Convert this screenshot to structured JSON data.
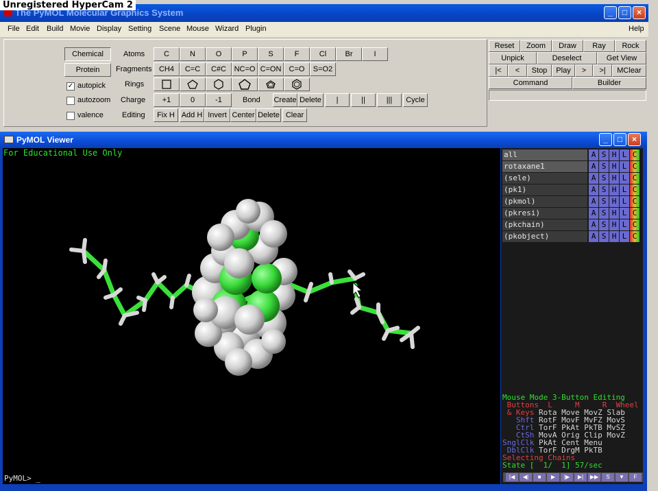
{
  "watermark": "Unregistered HyperCam 2",
  "main_window": {
    "title": "The PyMOL Molecular Graphics System",
    "controls": {
      "minimize": "_",
      "maximize": "□",
      "close": "×"
    }
  },
  "menubar": [
    "File",
    "Edit",
    "Build",
    "Movie",
    "Display",
    "Setting",
    "Scene",
    "Mouse",
    "Wizard",
    "Plugin",
    "Help"
  ],
  "builder": {
    "modes": {
      "chemical": "Chemical",
      "protein": "Protein"
    },
    "options": {
      "autopick": "autopick",
      "autozoom": "autozoom",
      "valence": "valence"
    },
    "autopick_checked": "✓",
    "rows": {
      "atoms_label": "Atoms",
      "atoms": [
        "C",
        "N",
        "O",
        "P",
        "S",
        "F",
        "Cl",
        "Br",
        "I"
      ],
      "fragments_label": "Fragments",
      "fragments": [
        "CH4",
        "C=C",
        "C#C",
        "NC=O",
        "C=ON",
        "C=O",
        "S=O2"
      ],
      "rings_label": "Rings",
      "charge_label": "Charge",
      "charges": [
        "+1",
        "0",
        "-1"
      ],
      "bond_label": "Bond",
      "bond_buttons": [
        "Create",
        "Delete",
        "|",
        "||",
        "|||",
        "Cycle"
      ],
      "editing_label": "Editing",
      "editing": [
        "Fix H",
        "Add H",
        "Invert",
        "Center",
        "Delete",
        "Clear"
      ]
    }
  },
  "control_panel": {
    "row1": [
      "Reset",
      "Zoom",
      "Draw",
      "Ray",
      "Rock"
    ],
    "row2": [
      "Unpick",
      "Deselect",
      "Get View"
    ],
    "row3": [
      "|<",
      "<",
      "Stop",
      "Play",
      ">",
      ">|",
      "MClear"
    ],
    "row4": [
      "Command",
      "Builder"
    ]
  },
  "viewer": {
    "title": "PyMOL Viewer",
    "edu_notice": "For Educational Use Only",
    "prompt": "PyMOL> _"
  },
  "objects": [
    "all",
    "rotaxane1",
    "(sele)",
    "(pk1)",
    "(pkmol)",
    "(pkresi)",
    "(pkchain)",
    "(pkobject)"
  ],
  "object_buttons": [
    "A",
    "S",
    "H",
    "L",
    "C"
  ],
  "mouse_mode": {
    "line1": "Mouse Mode 3-Button Editing",
    "buttons_line": " Buttons  L     M     R  Wheel",
    "rows": [
      {
        "key": " & Keys",
        "vals": " Rota Move MovZ Slab"
      },
      {
        "key": "   Shft",
        "vals": " RotF MovF MvFZ MovS"
      },
      {
        "key": "   Ctrl",
        "vals": " TorF PkAt PkTB MvSZ"
      },
      {
        "key": "   CtSh",
        "vals": " MovA Orig Clip MovZ"
      },
      {
        "key": "SnglClk",
        "vals": " PkAt Cent Menu"
      },
      {
        "key": " DblClk",
        "vals": " TorF DrgM PkTB"
      }
    ],
    "selecting": "Selecting Chains",
    "state": "State [  1/  1] 57/sec"
  },
  "colors": {
    "green": "#2ee02e",
    "carbon": "#3ce03c",
    "hydrogen": "#d8d8d8",
    "titlebar": "#0a4bd8"
  }
}
